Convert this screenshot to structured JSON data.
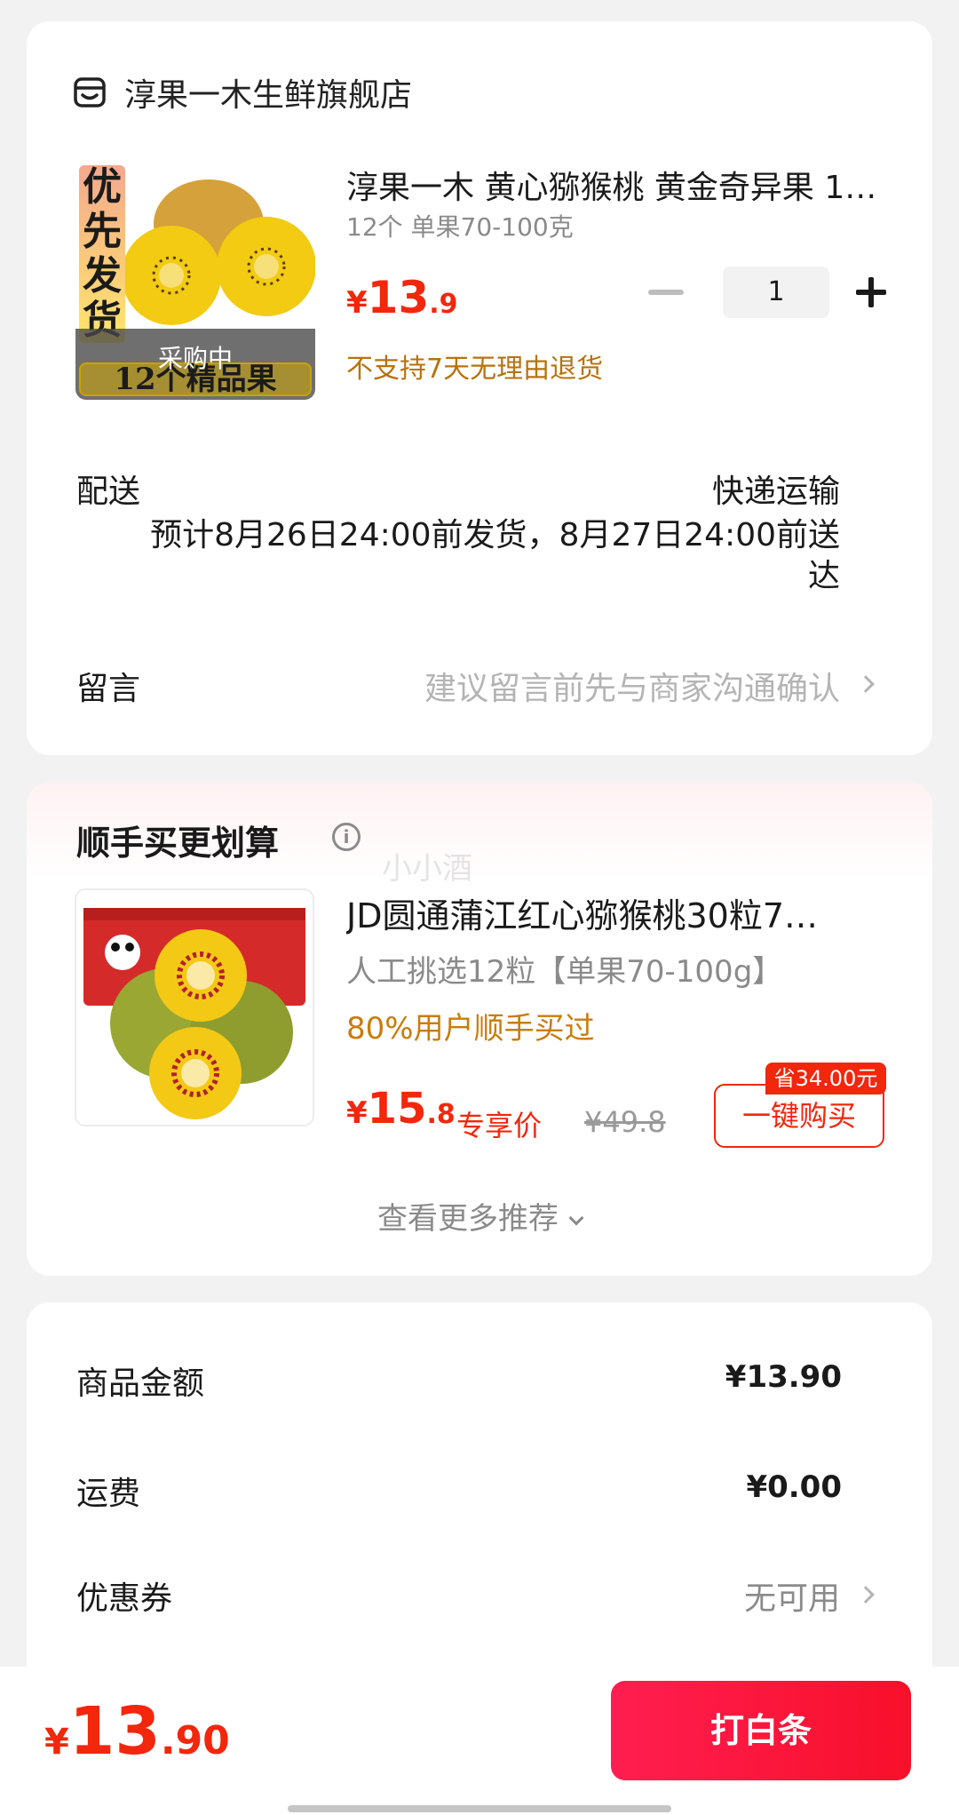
{
  "store": {
    "name": "淳果一木生鲜旗舰店",
    "icon": "store-icon"
  },
  "product": {
    "title": "淳果一木 黄心猕猴桃 黄金奇异果 12个 精品果",
    "spec": "12个 单果70-100克",
    "price_symbol": "¥",
    "price_int": "13",
    "price_dec": ".9",
    "quantity": "1",
    "return_note": "不支持7天无理由退货",
    "thumb_badge": "优先发货",
    "thumb_status": "采购中",
    "thumb_subtext": "12个精品果"
  },
  "shipping": {
    "label": "配送",
    "method": "快递运输",
    "estimate": "预计8月26日24:00前发货，8月27日24:00前送达"
  },
  "message": {
    "label": "留言",
    "hint": "建议留言前先与商家沟通确认"
  },
  "recommend": {
    "title": "顺手买更划算",
    "watermark": "小小酒",
    "item": {
      "title": "JD圆通蒲江红心猕猴桃30粒7…",
      "spec": "人工挑选12粒【单果70-100g】",
      "hot": "80%用户顺手买过",
      "price_symbol": "¥",
      "price_int": "15",
      "price_dec": ".8",
      "exclusive_label": "专享价",
      "original_price": "¥49.8",
      "save_badge": "省34.00元",
      "buy_label": "一键购买"
    },
    "more_label": "查看更多推荐"
  },
  "summary": {
    "goods_label": "商品金额",
    "goods_value": "¥13.90",
    "freight_label": "运费",
    "freight_value": "¥0.00",
    "coupon_label": "优惠券",
    "coupon_value": "无可用"
  },
  "bottom": {
    "total_symbol": "¥",
    "total_int": "13",
    "total_dec": ".90",
    "pay_label": "打白条"
  },
  "colors": {
    "accent_red": "#f2270c",
    "note_orange": "#b8720d",
    "pay_gradient_start": "#ff1e50"
  }
}
